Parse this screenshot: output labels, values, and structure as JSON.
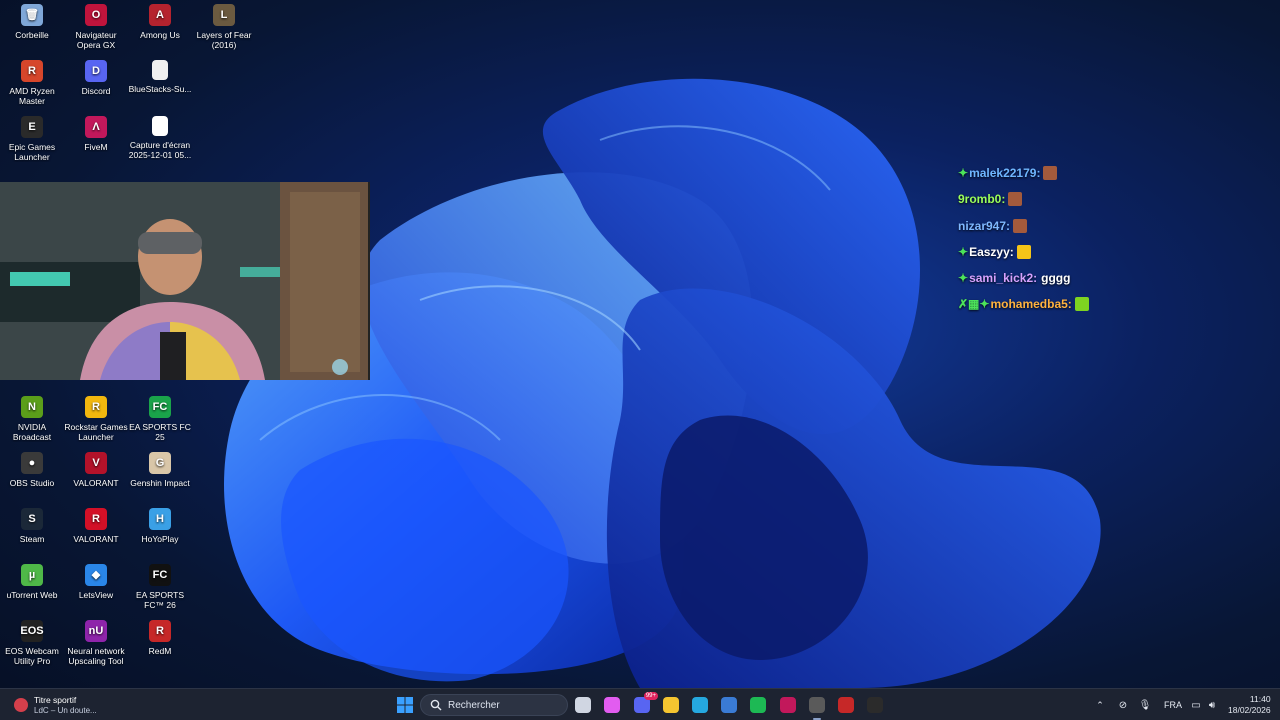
{
  "desktop": {
    "icons": [
      {
        "name": "recycle-bin-icon",
        "label": "Corbeille",
        "color": "#7fa7d8",
        "glyph": "🗑"
      },
      {
        "name": "opera-gx-icon",
        "label": "Navigateur Opera GX",
        "color": "#c0143c",
        "glyph": "O"
      },
      {
        "name": "among-us-icon",
        "label": "Among Us",
        "color": "#b5232e",
        "glyph": "A"
      },
      {
        "name": "layers-of-fear-icon",
        "label": "Layers of Fear (2016)",
        "color": "#6b5a40",
        "glyph": "L"
      },
      {
        "name": "amd-ryzen-master-icon",
        "label": "AMD Ryzen Master",
        "color": "#d6462b",
        "glyph": "R"
      },
      {
        "name": "discord-icon",
        "label": "Discord",
        "color": "#5865f2",
        "glyph": "D"
      },
      {
        "name": "bluestacks-file-icon",
        "label": "BlueStacks-Su...",
        "color": "#f0f0f0",
        "glyph": ""
      },
      {
        "name": "epic-games-icon",
        "label": "Epic Games Launcher",
        "color": "#2a2a2a",
        "glyph": "E"
      },
      {
        "name": "fivem-icon",
        "label": "FiveM",
        "color": "#c2185b",
        "glyph": "Λ"
      },
      {
        "name": "screenshot-file-icon",
        "label": "Capture d'écran 2025-12-01 05...",
        "color": "#ffffff",
        "glyph": ""
      },
      {
        "name": "nvidia-broadcast-icon",
        "label": "NVIDIA Broadcast",
        "color": "#5b9e1a",
        "glyph": "N"
      },
      {
        "name": "rockstar-games-icon",
        "label": "Rockstar Games Launcher",
        "color": "#f2b70e",
        "glyph": "R"
      },
      {
        "name": "ea-sports-fc25-icon",
        "label": "EA SPORTS FC 25",
        "color": "#1aa34a",
        "glyph": "FC"
      },
      {
        "name": "obs-studio-icon",
        "label": "OBS Studio",
        "color": "#3a3a3a",
        "glyph": "●"
      },
      {
        "name": "valorant-icon",
        "label": "VALORANT",
        "color": "#b3122a",
        "glyph": "V"
      },
      {
        "name": "genshin-impact-icon",
        "label": "Genshin Impact",
        "color": "#d9c6a8",
        "glyph": "G"
      },
      {
        "name": "steam-icon",
        "label": "Steam",
        "color": "#1b2838",
        "glyph": "S"
      },
      {
        "name": "valorant-riot-icon",
        "label": "VALORANT",
        "color": "#d31027",
        "glyph": "R"
      },
      {
        "name": "hoyoplay-icon",
        "label": "HoYoPlay",
        "color": "#3aa0e6",
        "glyph": "H"
      },
      {
        "name": "utorrent-web-icon",
        "label": "uTorrent Web",
        "color": "#4fb848",
        "glyph": "µ"
      },
      {
        "name": "letsview-icon",
        "label": "LetsView",
        "color": "#2a86e8",
        "glyph": "◆"
      },
      {
        "name": "ea-sports-fc26-icon",
        "label": "EA SPORTS FC™ 26",
        "color": "#111111",
        "glyph": "FC"
      },
      {
        "name": "eos-webcam-icon",
        "label": "EOS Webcam Utility Pro",
        "color": "#222222",
        "glyph": "EOS"
      },
      {
        "name": "neural-network-icon",
        "label": "Neural network Upscaling Tool",
        "color": "#8e24aa",
        "glyph": "nU"
      },
      {
        "name": "redm-icon",
        "label": "RedM",
        "color": "#c62828",
        "glyph": "R"
      }
    ]
  },
  "chat": {
    "lines": [
      {
        "badge": "✦",
        "user": "malek22179:",
        "userColor": "#6fb6ff",
        "emote": "#a35a3c",
        "msg": ""
      },
      {
        "badge": "",
        "user": "9romb0:",
        "userColor": "#9bff5a",
        "emote": "#a35a3c",
        "msg": ""
      },
      {
        "badge": "",
        "user": "nizar947:",
        "userColor": "#7fb8ff",
        "emote": "#a35a3c",
        "msg": ""
      },
      {
        "badge": "✦",
        "user": "Easzyy:",
        "userColor": "#ffffff",
        "emote": "#f5c518",
        "msg": ""
      },
      {
        "badge": "✦",
        "user": "sami_kick2:",
        "userColor": "#d6a2ff",
        "emote": "",
        "msg": "gggg"
      },
      {
        "badge": "✗▦✦",
        "user": "mohamedba5:",
        "userColor": "#ffb23f",
        "emote": "#7ed321",
        "msg": ""
      }
    ]
  },
  "taskbar": {
    "widget": {
      "title": "Titre sportif",
      "subtitle": "LdC – Un doute..."
    },
    "search_placeholder": "Rechercher",
    "apps": [
      {
        "name": "task-view-icon",
        "color": "#d0d6e2"
      },
      {
        "name": "copilot-icon",
        "color": "#e25cf0"
      },
      {
        "name": "discord-taskbar-icon",
        "color": "#5865f2",
        "badge": "99+"
      },
      {
        "name": "file-explorer-icon",
        "color": "#f4c430"
      },
      {
        "name": "edge-icon",
        "color": "#25a8e0"
      },
      {
        "name": "microsoft-store-icon",
        "color": "#3a7bd5"
      },
      {
        "name": "spotify-icon",
        "color": "#1db954"
      },
      {
        "name": "fivem-taskbar-icon",
        "color": "#c2185b"
      },
      {
        "name": "obs-taskbar-icon",
        "color": "#5a5a5a"
      },
      {
        "name": "redm-taskbar-icon",
        "color": "#c62828"
      },
      {
        "name": "streamlabs-icon",
        "color": "#2b2b2b"
      }
    ],
    "tray": {
      "language": "FRA",
      "time": "11:40",
      "date": "18/02/2026"
    }
  }
}
